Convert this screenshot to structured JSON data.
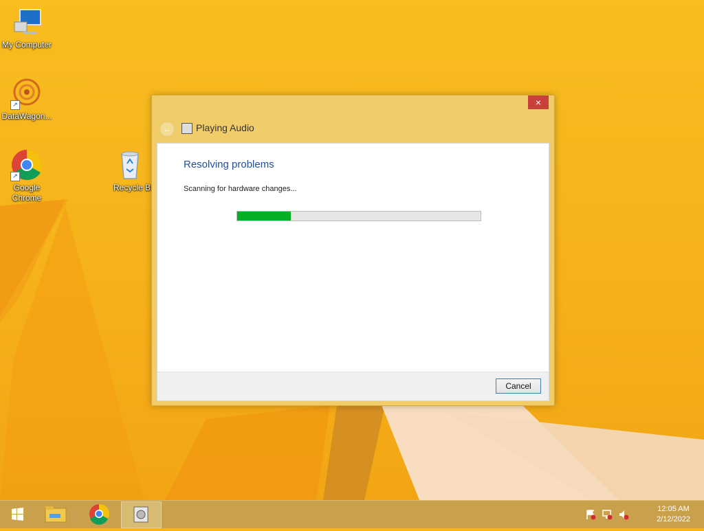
{
  "desktop": {
    "icons": [
      {
        "label": "My Computer",
        "icon": "computer-icon"
      },
      {
        "label": "DataWagon...",
        "icon": "datawagon-icon"
      },
      {
        "label": "Google Chrome",
        "icon": "chrome-icon"
      },
      {
        "label": "Recycle Bi",
        "icon": "recycle-bin-icon"
      }
    ]
  },
  "dialog": {
    "title": "Playing Audio",
    "close_label": "×",
    "heading": "Resolving problems",
    "status": "Scanning for hardware changes...",
    "progress": 0.22,
    "cancel_label": "Cancel"
  },
  "taskbar": {
    "time": "12:05 AM",
    "date": "2/12/2022",
    "items": [
      "start-icon",
      "file-explorer-icon",
      "chrome-icon",
      "playing-audio-icon"
    ],
    "tray_icons": [
      "action-center-flag-icon",
      "network-icon",
      "volume-muted-icon"
    ]
  },
  "colors": {
    "accent": "#06b025",
    "heading": "#1e4f9a",
    "close": "#c7413a"
  }
}
